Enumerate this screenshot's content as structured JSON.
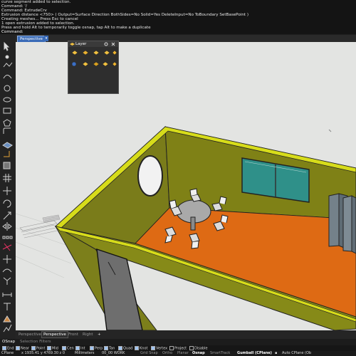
{
  "command_history": [
    "curve segment added to selection.",
    "Command: '/",
    "Command: ExtrudeCrv",
    "Extrusion distance <750> ( Output=Surface  Direction  BothSides=No  Solid=Yes  DeleteInput=No  ToBoundary  SetBasePoint )",
    "Creating meshes... Press Esc to cancel",
    "1 open extrusion added to selection.",
    "Press and hold Alt to temporarily toggle osnap, tap Alt to make a duplicate"
  ],
  "command_prompt": "Command:",
  "viewport": {
    "active_tab": "Perspective",
    "menu_arrow": "▾"
  },
  "layer_panel": {
    "title": "Layer",
    "settings_icon": "gear-icon",
    "close_icon": "close-icon"
  },
  "bottom_tabs": {
    "tabs": [
      "Perspective",
      "Perspective",
      "Front",
      "Right"
    ],
    "active_index": 1,
    "add": "+"
  },
  "osnap_tabs": {
    "osnap": "OSnap",
    "filters": "Selection Filters"
  },
  "osnaps": [
    {
      "label": "End",
      "on": true
    },
    {
      "label": "Near",
      "on": true
    },
    {
      "label": "Point",
      "on": true
    },
    {
      "label": "Mid",
      "on": true
    },
    {
      "label": "Cen",
      "on": true
    },
    {
      "label": "Int",
      "on": true
    },
    {
      "label": "Perp",
      "on": true
    },
    {
      "label": "Tan",
      "on": true
    },
    {
      "label": "Quad",
      "on": true
    },
    {
      "label": "Knot",
      "on": true
    },
    {
      "label": "Vertex",
      "on": true
    },
    {
      "label": "Project",
      "on": false
    },
    {
      "label": "Disable",
      "on": false
    }
  ],
  "status_bar": {
    "cplane": "CPlane",
    "coords": "x 1935.41  y 4769.30  z 0",
    "units": "Millimeters",
    "layer": "00_00 WORK",
    "grid_snap": "Grid Snap",
    "ortho": "Ortho",
    "planar": "Planar",
    "osnap": "Osnap",
    "smarttrack": "SmartTrack",
    "gumball": "Gumball (CPlane)",
    "auto_cplane": "Auto CPlane (Ob"
  },
  "colors": {
    "wall": "#8a8c1c",
    "wall_top": "#d7dc1a",
    "floor": "#de6a14",
    "glass": "#2e8d86",
    "door": "#6e6e6e",
    "viewport_bg": "#e3e4e2",
    "active_tab": "#3a6bb7"
  }
}
